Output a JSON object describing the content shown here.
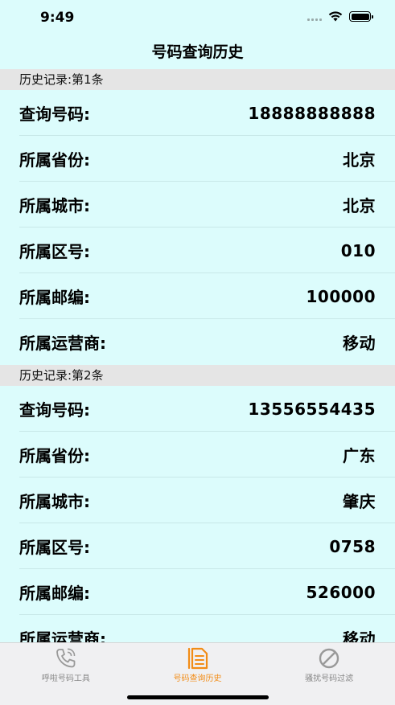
{
  "status_bar": {
    "time": "9:49"
  },
  "nav": {
    "title": "号码查询历史"
  },
  "records": [
    {
      "header": "历史记录:第1条",
      "rows": [
        {
          "label": "查询号码:",
          "value": "18888888888"
        },
        {
          "label": "所属省份:",
          "value": "北京"
        },
        {
          "label": "所属城市:",
          "value": "北京"
        },
        {
          "label": "所属区号:",
          "value": "010"
        },
        {
          "label": "所属邮编:",
          "value": "100000"
        },
        {
          "label": "所属运营商:",
          "value": "移动"
        }
      ]
    },
    {
      "header": "历史记录:第2条",
      "rows": [
        {
          "label": "查询号码:",
          "value": "13556554435"
        },
        {
          "label": "所属省份:",
          "value": "广东"
        },
        {
          "label": "所属城市:",
          "value": "肇庆"
        },
        {
          "label": "所属区号:",
          "value": "0758"
        },
        {
          "label": "所属邮编:",
          "value": "526000"
        },
        {
          "label": "所属运营商:",
          "value": "移动"
        }
      ]
    }
  ],
  "tabs": [
    {
      "label": "呼啦号码工具",
      "icon": "phone-icon",
      "active": false
    },
    {
      "label": "号码查询历史",
      "icon": "document-icon",
      "active": true
    },
    {
      "label": "骚扰号码过滤",
      "icon": "block-icon",
      "active": false
    }
  ],
  "colors": {
    "background": "#dcfcfc",
    "accent": "#f28c16",
    "inactive": "#888888"
  }
}
